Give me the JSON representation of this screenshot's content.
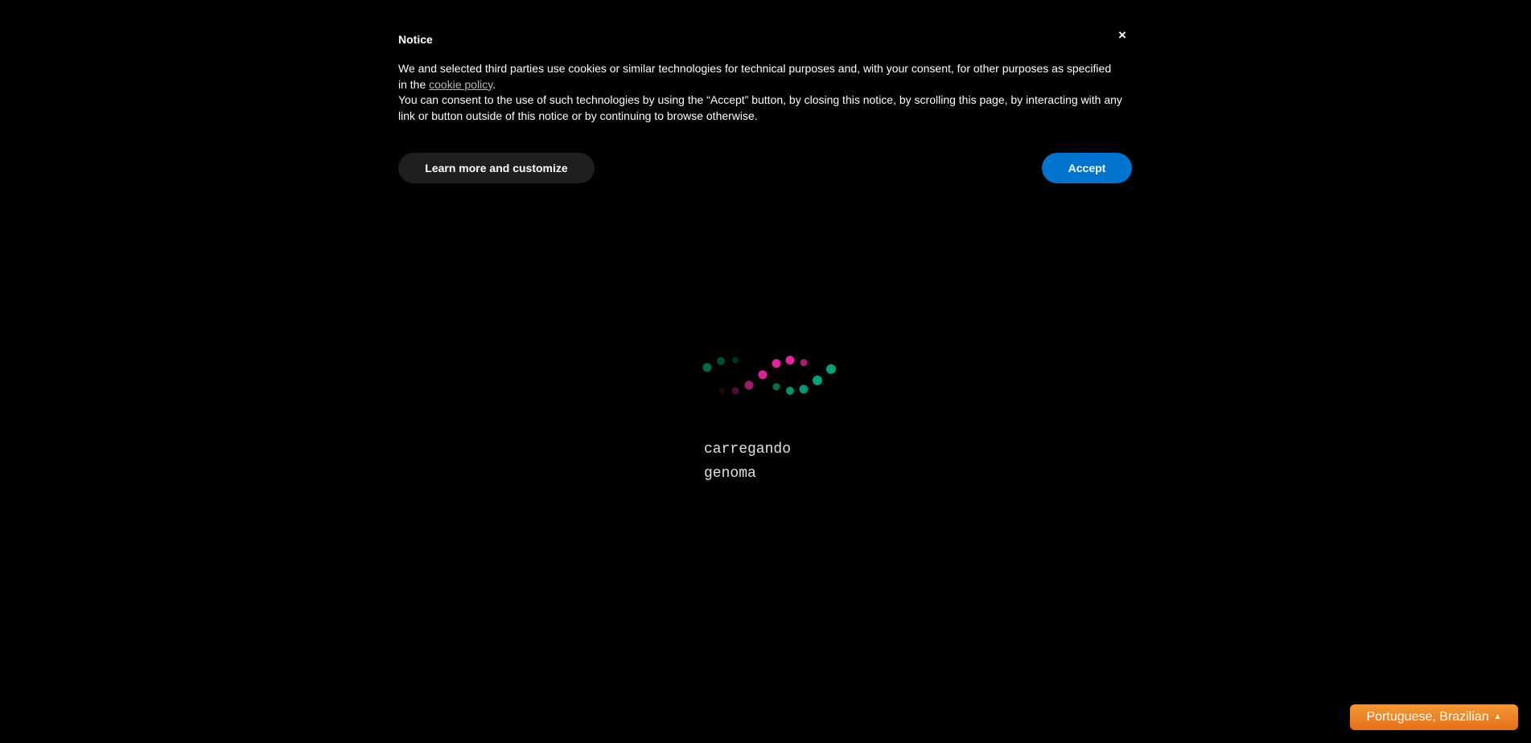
{
  "notice": {
    "title": "Notice",
    "close_label": "×",
    "line1_before_link": "We and selected third parties use cookies or similar technologies for technical purposes and, with your consent, for other purposes as specified in the ",
    "link_label": "cookie policy",
    "line1_after_link": ".",
    "line2": "You can consent to the use of such technologies by using the “Accept” button, by closing this notice, by scrolling this page, by interacting with any link or button outside of this notice or by continuing to browse otherwise.",
    "customize_label": "Learn more and customize",
    "accept_label": "Accept",
    "accept_color": "#0073ce"
  },
  "loader": {
    "line1": "carregando",
    "line2": "genoma",
    "colors": {
      "pink": "#e0269c",
      "green": "#00a07a"
    }
  },
  "language_selector": {
    "label": "Portuguese, Brazilian",
    "icon": "caret-up-icon",
    "caret_glyph": "▲"
  }
}
